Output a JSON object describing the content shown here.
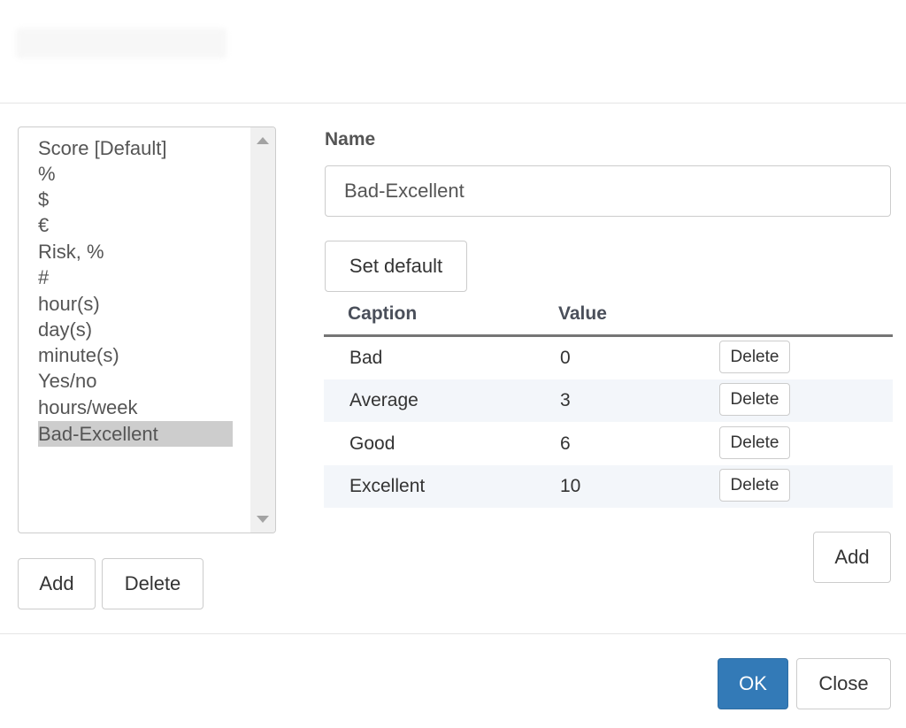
{
  "units": {
    "items": [
      "Score [Default]",
      "%",
      "$",
      "€",
      "Risk, %",
      "#",
      "hour(s)",
      "day(s)",
      "minute(s)",
      "Yes/no",
      "hours/week",
      "Bad-Excellent"
    ],
    "selected": "Bad-Excellent"
  },
  "left_buttons": {
    "add": "Add",
    "delete": "Delete"
  },
  "editor": {
    "name_label": "Name",
    "name_value": "Bad-Excellent",
    "set_default": "Set default"
  },
  "table": {
    "headers": {
      "caption": "Caption",
      "value": "Value"
    },
    "rows": [
      {
        "caption": "Bad",
        "value": "0",
        "action": "Delete"
      },
      {
        "caption": "Average",
        "value": "3",
        "action": "Delete"
      },
      {
        "caption": "Good",
        "value": "6",
        "action": "Delete"
      },
      {
        "caption": "Excellent",
        "value": "10",
        "action": "Delete"
      }
    ],
    "add": "Add"
  },
  "footer": {
    "ok": "OK",
    "close": "Close"
  },
  "colors": {
    "primary": "#337ab7",
    "selected_item": "#cdcdcd",
    "row_stripe": "#f3f6fa"
  }
}
